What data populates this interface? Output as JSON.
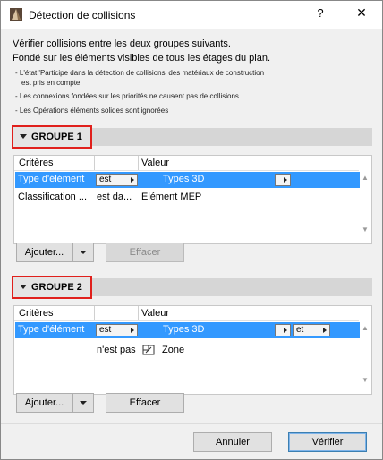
{
  "window": {
    "title": "Détection de collisions",
    "help": "?",
    "close": "✕"
  },
  "description": {
    "line1": "Vérifier collisions entre les deux groupes suivants.",
    "line2": "Fondé sur les éléments visibles de tous les étages du plan.",
    "notes": [
      "- L'état 'Participe dans la détection de collisions' des matériaux de construction",
      "est pris en compte",
      "- Les connexions fondées sur les priorités ne causent pas de collisions",
      "- Les Opérations éléments solides sont ignorées"
    ]
  },
  "group1": {
    "label": "GROUPE 1",
    "columns": {
      "criteria": "Critères",
      "value": "Valeur"
    },
    "rows": [
      {
        "criteria": "Type d'élément",
        "operator": "est",
        "value": "Types 3D",
        "selected": true
      },
      {
        "criteria": "Classification ...",
        "operator": "est da...",
        "value": "Elément MEP",
        "selected": false
      }
    ],
    "add_label": "Ajouter...",
    "clear_label": "Effacer",
    "clear_enabled": false
  },
  "group2": {
    "label": "GROUPE 2",
    "columns": {
      "criteria": "Critères",
      "value": "Valeur"
    },
    "rows": [
      {
        "criteria": "Type d'élément",
        "operator": "est",
        "value": "Types 3D",
        "logic": "et",
        "selected": true
      },
      {
        "criteria": "",
        "operator": "n'est pas",
        "value": "Zone",
        "icon": "zone-icon",
        "selected": false
      }
    ],
    "add_label": "Ajouter...",
    "clear_label": "Effacer",
    "clear_enabled": true
  },
  "footer": {
    "cancel": "Annuler",
    "confirm": "Vérifier"
  },
  "colors": {
    "selection": "#3399ff",
    "highlight_border": "#e0201c"
  }
}
